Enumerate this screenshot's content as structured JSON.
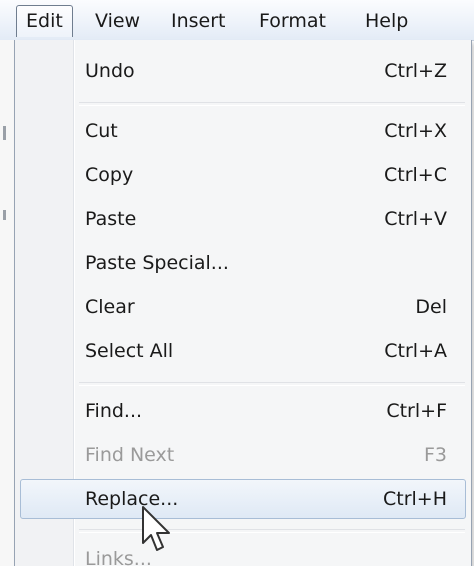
{
  "menubar": {
    "items": [
      {
        "label": "Edit",
        "active": true
      },
      {
        "label": "View",
        "active": false
      },
      {
        "label": "Insert",
        "active": false
      },
      {
        "label": "Format",
        "active": false
      },
      {
        "label": "Help",
        "active": false
      }
    ]
  },
  "edit_menu": {
    "items": [
      {
        "label": "Undo",
        "shortcut": "Ctrl+Z",
        "state": "enabled"
      },
      {
        "label": "Cut",
        "shortcut": "Ctrl+X",
        "state": "enabled"
      },
      {
        "label": "Copy",
        "shortcut": "Ctrl+C",
        "state": "enabled"
      },
      {
        "label": "Paste",
        "shortcut": "Ctrl+V",
        "state": "enabled"
      },
      {
        "label": "Paste Special...",
        "shortcut": "",
        "state": "enabled"
      },
      {
        "label": "Clear",
        "shortcut": "Del",
        "state": "enabled"
      },
      {
        "label": "Select All",
        "shortcut": "Ctrl+A",
        "state": "enabled"
      },
      {
        "label": "Find...",
        "shortcut": "Ctrl+F",
        "state": "enabled"
      },
      {
        "label": "Find Next",
        "shortcut": "F3",
        "state": "disabled"
      },
      {
        "label": "Replace...",
        "shortcut": "Ctrl+H",
        "state": "highlighted"
      },
      {
        "label": "Links...",
        "shortcut": "",
        "state": "disabled"
      }
    ]
  },
  "icons": {
    "pointer": "mouse-pointer-icon"
  },
  "colors": {
    "highlight_border": "#a8bdd6",
    "disabled_text": "#9a9a9a"
  }
}
